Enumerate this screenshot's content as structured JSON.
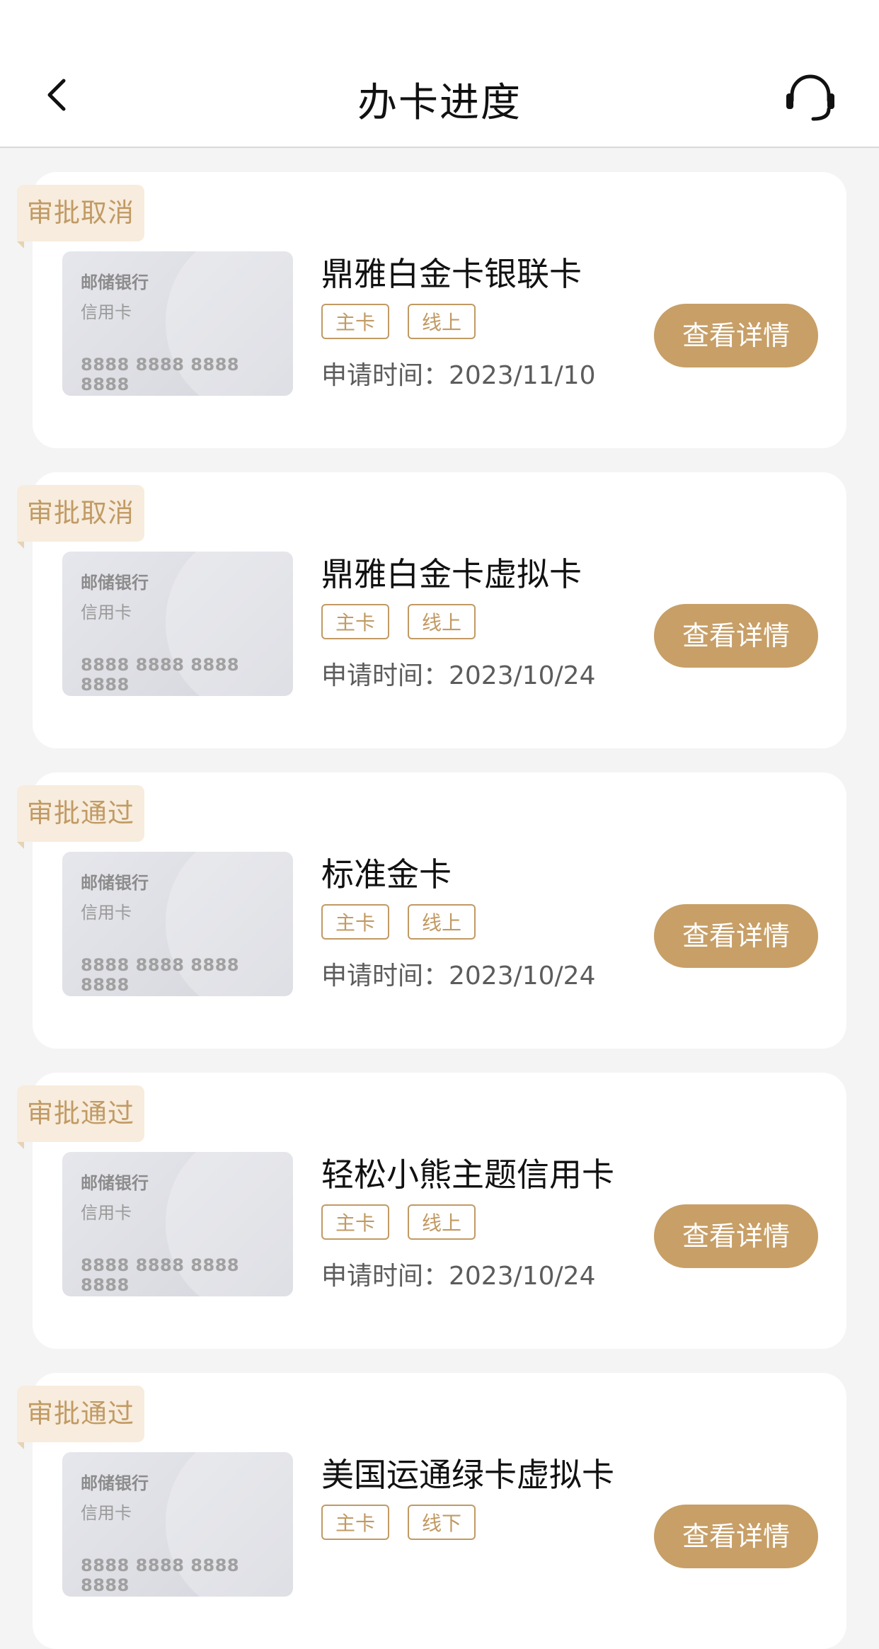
{
  "header": {
    "title": "办卡进度",
    "back_icon": "chevron-left-icon",
    "service_icon": "headset-icon"
  },
  "cards": [
    {
      "status": "审批取消",
      "bank": "邮储银行",
      "card_type": "信用卡",
      "card_number": "8888 8888 8888 8888",
      "name": "鼎雅白金卡银联卡",
      "tags": [
        "主卡",
        "线上"
      ],
      "apply_time": "申请时间：2023/11/10",
      "button": "查看详情"
    },
    {
      "status": "审批取消",
      "bank": "邮储银行",
      "card_type": "信用卡",
      "card_number": "8888 8888 8888 8888",
      "name": "鼎雅白金卡虚拟卡",
      "tags": [
        "主卡",
        "线上"
      ],
      "apply_time": "申请时间：2023/10/24",
      "button": "查看详情"
    },
    {
      "status": "审批通过",
      "bank": "邮储银行",
      "card_type": "信用卡",
      "card_number": "8888 8888 8888 8888",
      "name": "标准金卡",
      "tags": [
        "主卡",
        "线上"
      ],
      "apply_time": "申请时间：2023/10/24",
      "button": "查看详情"
    },
    {
      "status": "审批通过",
      "bank": "邮储银行",
      "card_type": "信用卡",
      "card_number": "8888 8888 8888 8888",
      "name": "轻松小熊主题信用卡",
      "tags": [
        "主卡",
        "线上"
      ],
      "apply_time": "申请时间：2023/10/24",
      "button": "查看详情"
    },
    {
      "status": "审批通过",
      "bank": "邮储银行",
      "card_type": "信用卡",
      "card_number": "8888 8888 8888 8888",
      "name": "美国运通绿卡虚拟卡",
      "tags": [
        "主卡",
        "线下"
      ],
      "apply_time": "",
      "button": "查看详情"
    }
  ],
  "colors": {
    "accent": "#c79f67",
    "tag_text": "#c19a64",
    "status_bg": "#f7ecdd",
    "page_bg": "#f4f4f4"
  }
}
